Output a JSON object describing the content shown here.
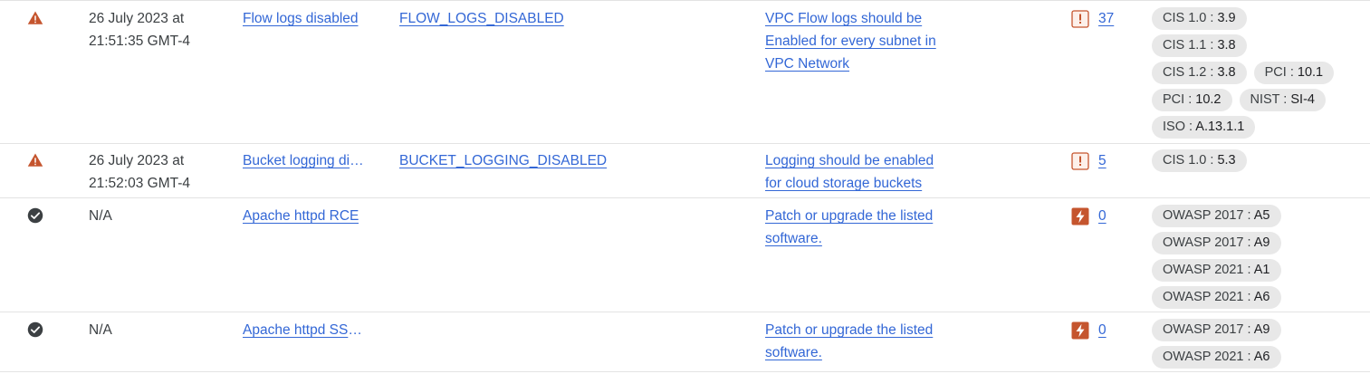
{
  "colors": {
    "link": "#3367d6",
    "warning": "#c5552e",
    "resolved": "#3c4043",
    "chip_bg": "#e8e8e8",
    "divider": "#e3e3e3"
  },
  "rows": [
    {
      "status_icon": "warning-triangle-icon",
      "time_line1": "26 July 2023 at",
      "time_line2": "21:51:35 GMT-4",
      "name": "Flow logs disabled",
      "category": "FLOW_LOGS_DISABLED",
      "recommendation": [
        "VPC Flow logs should be",
        "Enabled for every subnet in",
        "VPC Network"
      ],
      "resource_icon": "misconfiguration-icon",
      "resource_count": "37",
      "compliance": [
        {
          "label": "CIS 1.0",
          "value": "3.9"
        },
        {
          "label": "CIS 1.1",
          "value": "3.8"
        },
        {
          "label": "CIS 1.2",
          "value": "3.8"
        },
        {
          "label": "PCI",
          "value": "10.1"
        },
        {
          "label": "PCI",
          "value": "10.2"
        },
        {
          "label": "NIST",
          "value": "SI-4"
        },
        {
          "label": "ISO",
          "value": "A.13.1.1"
        }
      ]
    },
    {
      "status_icon": "warning-triangle-icon",
      "time_line1": "26 July 2023 at",
      "time_line2": "21:52:03 GMT-4",
      "name": "Bucket logging disabled",
      "category": "BUCKET_LOGGING_DISABLED",
      "recommendation": [
        "Logging should be enabled",
        "for cloud storage buckets"
      ],
      "resource_icon": "misconfiguration-icon",
      "resource_count": "5",
      "compliance": [
        {
          "label": "CIS 1.0",
          "value": "5.3"
        }
      ]
    },
    {
      "status_icon": "check-circle-icon",
      "time_line1": "N/A",
      "time_line2": "",
      "name": "Apache httpd RCE",
      "category": "",
      "recommendation": [
        "Patch or upgrade the listed",
        "software."
      ],
      "resource_icon": "vulnerability-icon",
      "resource_count": "0",
      "compliance": [
        {
          "label": "OWASP 2017",
          "value": "A5"
        },
        {
          "label": "OWASP 2017",
          "value": "A9"
        },
        {
          "label": "OWASP 2021",
          "value": "A1"
        },
        {
          "label": "OWASP 2021",
          "value": "A6"
        }
      ]
    },
    {
      "status_icon": "check-circle-icon",
      "time_line1": "N/A",
      "time_line2": "",
      "name": "Apache httpd SSRF",
      "category": "",
      "recommendation": [
        "Patch or upgrade the listed",
        "software."
      ],
      "resource_icon": "vulnerability-icon",
      "resource_count": "0",
      "compliance": [
        {
          "label": "OWASP 2017",
          "value": "A9"
        },
        {
          "label": "OWASP 2021",
          "value": "A6"
        }
      ]
    }
  ]
}
